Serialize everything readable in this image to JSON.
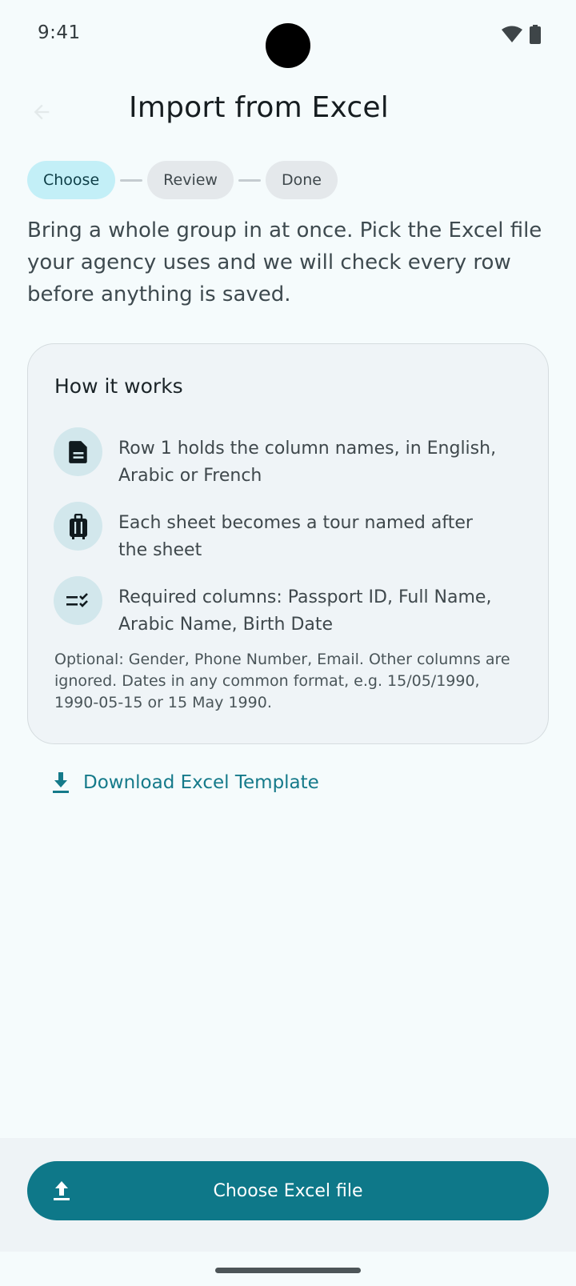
{
  "status_bar": {
    "time": "9:41"
  },
  "header": {
    "title": "Import from Excel"
  },
  "stepper": {
    "steps": [
      {
        "label": "Choose",
        "state": "active"
      },
      {
        "label": "Review",
        "state": "inactive"
      },
      {
        "label": "Done",
        "state": "inactive"
      }
    ]
  },
  "intro": "Bring a whole group in at once. Pick the Excel file your agency uses and we will check every row before anything is saved.",
  "card": {
    "title": "How it works",
    "items": [
      {
        "icon": "document-icon",
        "text": "Row 1 holds the column names, in English, Arabic or French"
      },
      {
        "icon": "luggage-icon",
        "text": "Each sheet becomes a tour named after the sheet"
      },
      {
        "icon": "checklist-icon",
        "text": "Required columns: Passport ID, Full Name, Arabic Name, Birth Date"
      }
    ],
    "note": "Optional: Gender, Phone Number, Email. Other columns are ignored. Dates in any common format, e.g. 15/05/1990, 1990-05-15 or 15 May 1990."
  },
  "download_link": {
    "label": "Download Excel Template",
    "icon": "download-icon"
  },
  "primary_action": {
    "label": "Choose Excel file",
    "icon": "upload-icon"
  },
  "colors": {
    "accent": "#0E7889",
    "active_step": "#C3EFF7",
    "link": "#157A8A"
  }
}
